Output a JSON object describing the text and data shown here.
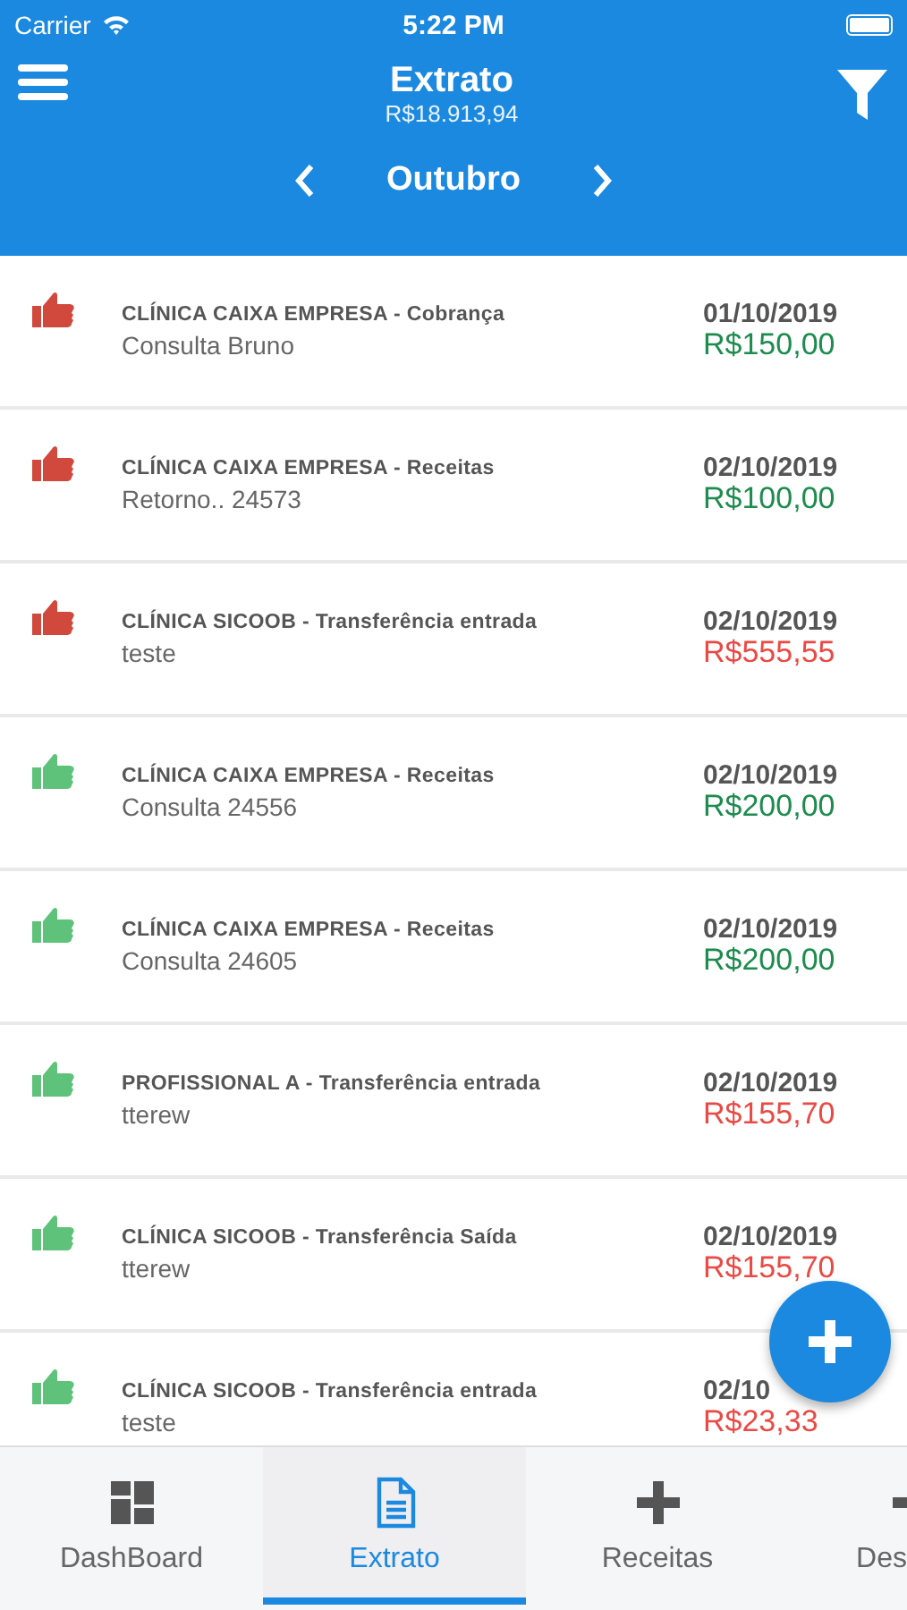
{
  "status_bar": {
    "carrier": "Carrier",
    "time": "5:22 PM"
  },
  "header": {
    "title": "Extrato",
    "balance": "R$18.913,94",
    "month": "Outubro"
  },
  "transactions": [
    {
      "color": "#d1493d",
      "title": "CLÍNICA CAIXA EMPRESA - Cobrança",
      "description": "Consulta Bruno",
      "date": "01/10/2019",
      "amount": "R$150,00",
      "kind": "income"
    },
    {
      "color": "#d1493d",
      "title": "CLÍNICA CAIXA EMPRESA - Receitas",
      "description": "Retorno.. 24573",
      "date": "02/10/2019",
      "amount": "R$100,00",
      "kind": "income"
    },
    {
      "color": "#d1493d",
      "title": "CLÍNICA SICOOB - Transferência entrada",
      "description": "teste",
      "date": "02/10/2019",
      "amount": "R$555,55",
      "kind": "expense"
    },
    {
      "color": "#5ec27a",
      "title": "CLÍNICA CAIXA EMPRESA - Receitas",
      "description": "Consulta 24556",
      "date": "02/10/2019",
      "amount": "R$200,00",
      "kind": "income"
    },
    {
      "color": "#5ec27a",
      "title": "CLÍNICA CAIXA EMPRESA - Receitas",
      "description": "Consulta 24605",
      "date": "02/10/2019",
      "amount": "R$200,00",
      "kind": "income"
    },
    {
      "color": "#5ec27a",
      "title": "PROFISSIONAL A - Transferência entrada",
      "description": "tterew",
      "date": "02/10/2019",
      "amount": "R$155,70",
      "kind": "expense"
    },
    {
      "color": "#5ec27a",
      "title": "CLÍNICA SICOOB - Transferência Saída",
      "description": "tterew",
      "date": "02/10/2019",
      "amount": "R$155,70",
      "kind": "expense"
    },
    {
      "color": "#5ec27a",
      "title": "CLÍNICA SICOOB - Transferência entrada",
      "description": "teste",
      "date": "02/10",
      "amount": "R$23,33",
      "kind": "expense"
    }
  ],
  "tabs": [
    {
      "kind": "dashboard",
      "label": "DashBoard",
      "selected": false
    },
    {
      "kind": "document",
      "label": "Extrato",
      "selected": true
    },
    {
      "kind": "plus",
      "label": "Receitas",
      "selected": false
    },
    {
      "kind": "minus",
      "label": "Des",
      "selected": false
    }
  ]
}
